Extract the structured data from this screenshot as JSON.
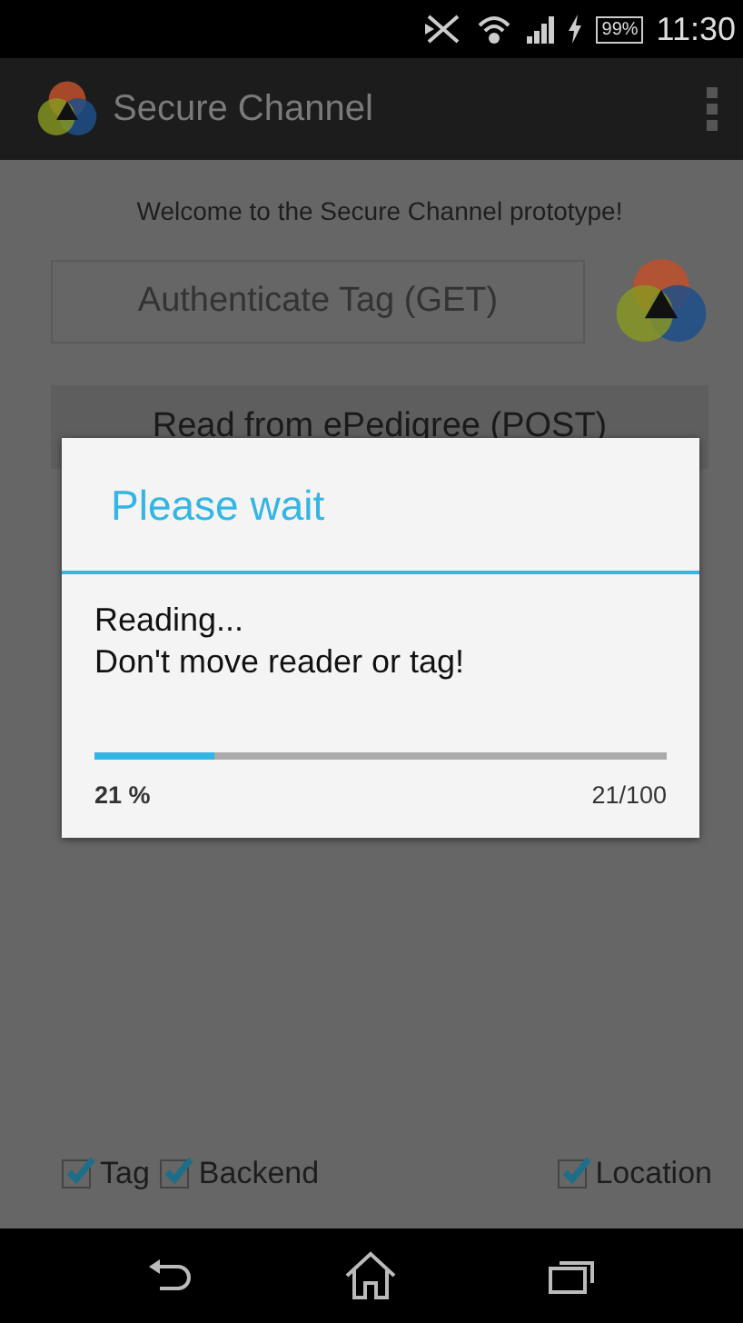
{
  "status_bar": {
    "battery": "99%",
    "time": "11:30"
  },
  "app_bar": {
    "title": "Secure Channel"
  },
  "welcome": "Welcome to the Secure Channel prototype!",
  "buttons": [
    {
      "label": "Authenticate Tag (GET)",
      "disabled": true
    },
    {
      "label": "Read from ePedigree (POST)",
      "disabled": false
    }
  ],
  "dialog": {
    "title": "Please wait",
    "message": [
      "Reading...",
      "Don't move reader or tag!"
    ],
    "progress": {
      "level": 0.21,
      "percent": "21 %",
      "count": "21/100"
    }
  },
  "checkboxes": [
    {
      "label": "Tag",
      "checked": true
    },
    {
      "label": "Backend",
      "checked": true
    },
    {
      "label": "Location",
      "checked": true
    }
  ]
}
